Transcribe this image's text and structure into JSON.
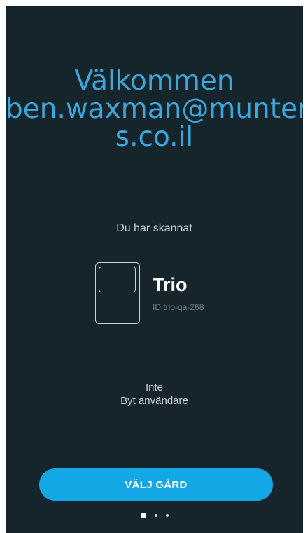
{
  "welcome": {
    "line1": "Välkommen",
    "line2": "ben.waxman@munter",
    "line3": "s.co.il"
  },
  "scan": {
    "label": "Du har skannat",
    "device_name": "Trio",
    "device_id": "ID trio-qa-268",
    "device_icon": "controller-device-icon"
  },
  "account": {
    "not_label": "Inte",
    "switch_user_link": "Byt användare"
  },
  "actions": {
    "choose_farm_label": "VÄLJ GÅRD"
  },
  "pager": {
    "total_pages": 3,
    "current_page": 1
  },
  "colors": {
    "background": "#16252b",
    "accent": "#3ba7da",
    "button": "#14a7e5",
    "text_muted": "#c9d0d3",
    "text_id": "#6f7d83"
  }
}
